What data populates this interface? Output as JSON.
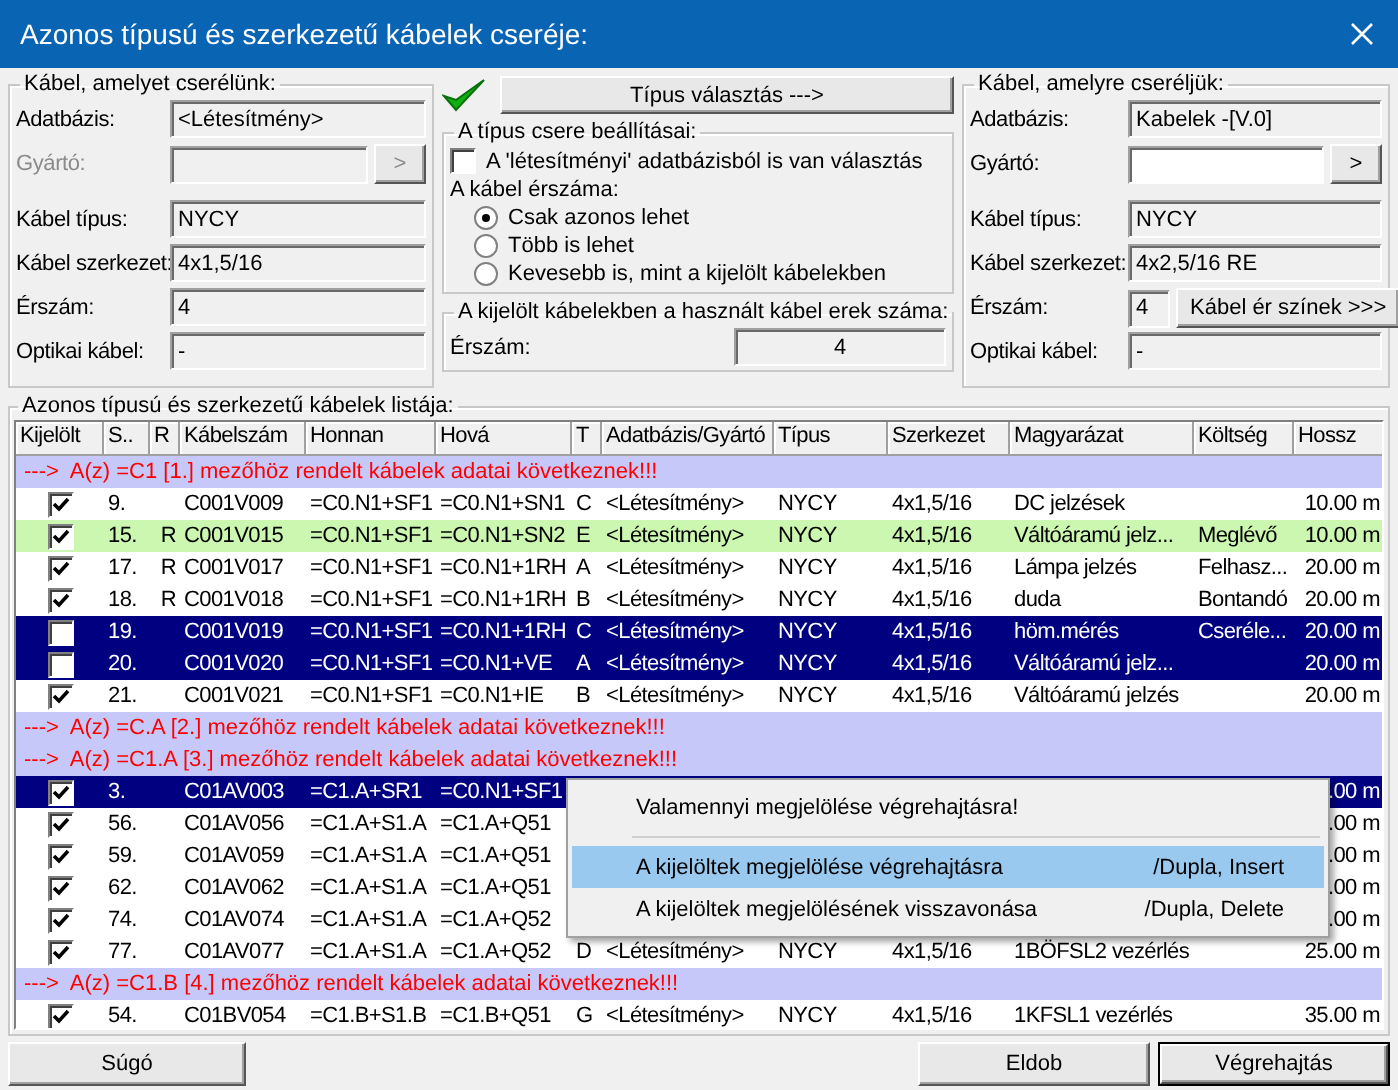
{
  "window": {
    "title": "Azonos típusú és szerkezetű kábelek cseréje:"
  },
  "source": {
    "title": "Kábel, amelyet cserélünk:",
    "fields": [
      {
        "label": "Adatbázis:",
        "value": "<Létesítmény>",
        "kind": "text",
        "disabled": false
      },
      {
        "label": "Gyártó:",
        "kind": "picker",
        "button": ">",
        "disabled": true
      },
      {
        "label": "Kábel típus:",
        "value": "NYCY",
        "kind": "text",
        "disabled": false
      },
      {
        "label": "Kábel szerkezet:",
        "value": "4x1,5/16",
        "kind": "text",
        "disabled": false
      },
      {
        "label": "Érszám:",
        "value": "4",
        "kind": "text",
        "disabled": false
      },
      {
        "label": "Optikai kábel:",
        "value": "-",
        "kind": "text",
        "disabled": false
      }
    ]
  },
  "type_button": {
    "label": "Típus választás --->",
    "confirmed": true
  },
  "settings": {
    "title": "A típus csere beállításai:",
    "checkbox": {
      "label": "A 'létesítményi' adatbázisból is van választás",
      "checked": false
    },
    "count_label": "A kábel érszáma:",
    "options": [
      {
        "label": "Csak azonos lehet",
        "selected": true
      },
      {
        "label": "Több is lehet",
        "selected": false
      },
      {
        "label": "Kevesebb is, mint a kijelölt kábelekben",
        "selected": false
      }
    ]
  },
  "used": {
    "title": "A kijelölt kábelekben a használt kábel erek száma:",
    "label": "Érszám:",
    "value": "4"
  },
  "target": {
    "title": "Kábel, amelyre cseréljük:",
    "fields": [
      {
        "label": "Adatbázis:",
        "value": "Kabelek -[V.0]",
        "kind": "text",
        "disabled": false
      },
      {
        "label": "Gyártó:",
        "kind": "picker",
        "button": ">",
        "disabled": false
      },
      {
        "label": "Kábel típus:",
        "value": "NYCY",
        "kind": "text",
        "disabled": false
      },
      {
        "label": "Kábel szerkezet:",
        "value": "4x2,5/16 RE",
        "kind": "text",
        "disabled": false
      },
      {
        "label": "Érszám:",
        "value": "4",
        "kind": "count",
        "button": "Kábel ér színek >>>",
        "disabled": false
      },
      {
        "label": "Optikai kábel:",
        "value": "-",
        "kind": "text",
        "disabled": false
      }
    ]
  },
  "list": {
    "title": "Azonos típusú és szerkezetű kábelek listája:",
    "columns": [
      "Kijelölt",
      "S..",
      "R",
      "Kábelszám",
      "Honnan",
      "Hová",
      "T",
      "Adatbázis/Gyártó",
      "Típus",
      "Szerkezet",
      "Magyarázat",
      "Költség",
      "Hossz"
    ],
    "rows": [
      {
        "kind": "group",
        "text": "--->  A(z) =C1 [1.] mezőhöz rendelt kábelek adatai következnek!!!"
      },
      {
        "kind": "cable",
        "checked": true,
        "selected": false,
        "highlighted": false,
        "number": "9.",
        "cable": "C001V009",
        "from": "=C0.N1+SF1",
        "to": "=C0.N1+SN1",
        "t": "C",
        "database": "<Létesítmény>",
        "type": "NYCY",
        "structure": "4x1,5/16",
        "note": "DC jelzések",
        "length": "10.00 m"
      },
      {
        "kind": "cable",
        "checked": true,
        "selected": false,
        "highlighted": true,
        "number": "15.",
        "r": "R",
        "cable": "C001V015",
        "from": "=C0.N1+SF1",
        "to": "=C0.N1+SN2",
        "t": "E",
        "database": "<Létesítmény>",
        "type": "NYCY",
        "structure": "4x1,5/16",
        "note": "Váltóáramú jelz...",
        "cost": "Meglévő",
        "length": "10.00 m"
      },
      {
        "kind": "cable",
        "checked": true,
        "selected": false,
        "highlighted": false,
        "number": "17.",
        "r": "R",
        "cable": "C001V017",
        "from": "=C0.N1+SF1",
        "to": "=C0.N1+1RH",
        "t": "A",
        "database": "<Létesítmény>",
        "type": "NYCY",
        "structure": "4x1,5/16",
        "note": "Lámpa jelzés",
        "cost": "Felhasz...",
        "length": "20.00 m"
      },
      {
        "kind": "cable",
        "checked": true,
        "selected": false,
        "highlighted": false,
        "number": "18.",
        "r": "R",
        "cable": "C001V018",
        "from": "=C0.N1+SF1",
        "to": "=C0.N1+1RH",
        "t": "B",
        "database": "<Létesítmény>",
        "type": "NYCY",
        "structure": "4x1,5/16",
        "note": "duda",
        "cost": "Bontandó",
        "length": "20.00 m"
      },
      {
        "kind": "cable",
        "checked": false,
        "selected": true,
        "highlighted": false,
        "number": "19.",
        "cable": "C001V019",
        "from": "=C0.N1+SF1",
        "to": "=C0.N1+1RH",
        "t": "C",
        "database": "<Létesítmény>",
        "type": "NYCY",
        "structure": "4x1,5/16",
        "note": "höm.mérés",
        "cost": "Cseréle...",
        "length": "20.00 m"
      },
      {
        "kind": "cable",
        "checked": false,
        "selected": true,
        "highlighted": false,
        "number": "20.",
        "cable": "C001V020",
        "from": "=C0.N1+SF1",
        "to": "=C0.N1+VE",
        "t": "A",
        "database": "<Létesítmény>",
        "type": "NYCY",
        "structure": "4x1,5/16",
        "note": "Váltóáramú jelz...",
        "length": "20.00 m"
      },
      {
        "kind": "cable",
        "checked": true,
        "selected": false,
        "highlighted": false,
        "number": "21.",
        "cable": "C001V021",
        "from": "=C0.N1+SF1",
        "to": "=C0.N1+IE",
        "t": "B",
        "database": "<Létesítmény>",
        "type": "NYCY",
        "structure": "4x1,5/16",
        "note": "Váltóáramú jelzés",
        "length": "20.00 m"
      },
      {
        "kind": "group",
        "text": "--->  A(z) =C.A [2.] mezőhöz rendelt kábelek adatai következnek!!!"
      },
      {
        "kind": "group",
        "text": "--->  A(z) =C1.A [3.] mezőhöz rendelt kábelek adatai következnek!!!"
      },
      {
        "kind": "cable",
        "checked": true,
        "selected": true,
        "highlighted": false,
        "number": "3.",
        "cable": "C01AV003",
        "from": "=C1.A+SR1",
        "to": "=C0.N1+SF1",
        "length": ".00 m"
      },
      {
        "kind": "cable",
        "checked": true,
        "selected": false,
        "highlighted": false,
        "number": "56.",
        "cable": "C01AV056",
        "from": "=C1.A+S1.A",
        "to": "=C1.A+Q51",
        "length": ".00 m"
      },
      {
        "kind": "cable",
        "checked": true,
        "selected": false,
        "highlighted": false,
        "number": "59.",
        "cable": "C01AV059",
        "from": "=C1.A+S1.A",
        "to": "=C1.A+Q51",
        "length": ".00 m"
      },
      {
        "kind": "cable",
        "checked": true,
        "selected": false,
        "highlighted": false,
        "number": "62.",
        "cable": "C01AV062",
        "from": "=C1.A+S1.A",
        "to": "=C1.A+Q51",
        "length": ".00 m"
      },
      {
        "kind": "cable",
        "checked": true,
        "selected": false,
        "highlighted": false,
        "number": "74.",
        "cable": "C01AV074",
        "from": "=C1.A+S1.A",
        "to": "=C1.A+Q52",
        "length": ".00 m"
      },
      {
        "kind": "cable",
        "checked": true,
        "selected": false,
        "highlighted": false,
        "number": "77.",
        "cable": "C01AV077",
        "from": "=C1.A+S1.A",
        "to": "=C1.A+Q52",
        "t": "D",
        "database": "<Létesítmény>",
        "type": "NYCY",
        "structure": "4x1,5/16",
        "note": "1BÖFSL2 vezérlés",
        "length": "25.00 m"
      },
      {
        "kind": "group",
        "text": "--->  A(z) =C1.B [4.] mezőhöz rendelt kábelek adatai következnek!!!"
      },
      {
        "kind": "cable",
        "checked": true,
        "selected": false,
        "highlighted": false,
        "number": "54.",
        "cable": "C01BV054",
        "from": "=C1.B+S1.B",
        "to": "=C1.B+Q51",
        "t": "G",
        "database": "<Létesítmény>",
        "type": "NYCY",
        "structure": "4x1,5/16",
        "note": "1KFSL1 vezérlés",
        "length": "35.00 m"
      }
    ]
  },
  "context_menu": {
    "items": [
      {
        "kind": "item",
        "label": "Valamennyi megjelölése végrehajtásra!",
        "selected": false
      },
      {
        "kind": "separator"
      },
      {
        "kind": "item",
        "label": "A kijelöltek megjelölése végrehajtásra",
        "shortcut": "/Dupla, Insert",
        "selected": true
      },
      {
        "kind": "item",
        "label": "A kijelöltek megjelölésének visszavonása",
        "shortcut": "/Dupla, Delete",
        "selected": false
      }
    ]
  },
  "buttons": [
    {
      "label": "Súgó",
      "default": false
    },
    {
      "label": "Eldob",
      "default": false
    },
    {
      "label": "Végrehajtás",
      "default": true
    }
  ]
}
